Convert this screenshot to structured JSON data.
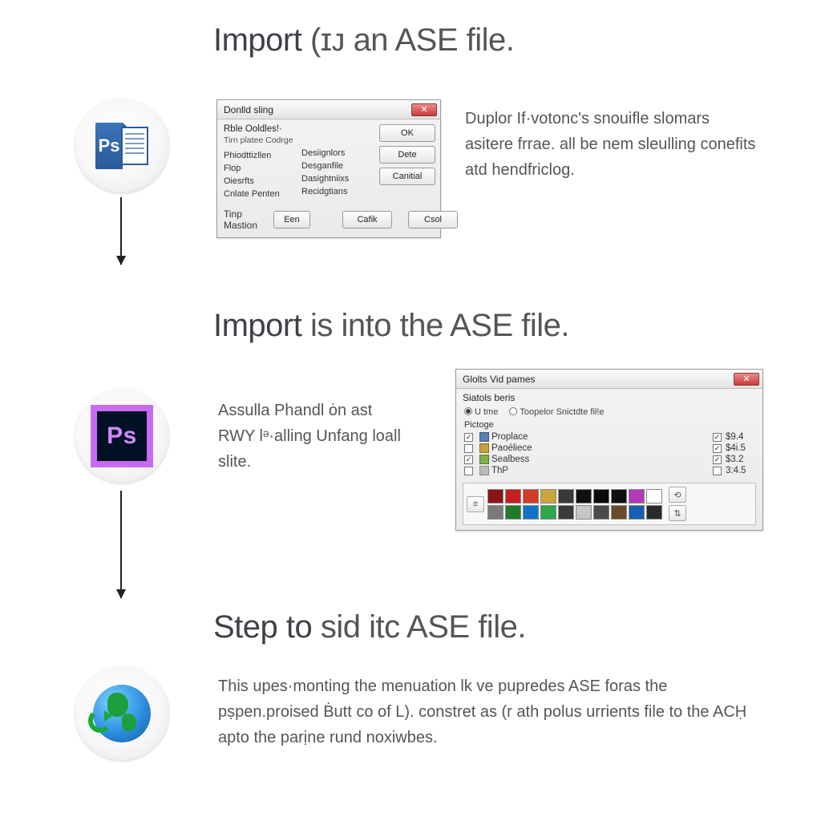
{
  "headings": {
    "h1_a": "Import",
    "h1_b": "(ɪᴊ",
    "h1_c": "an ASE file.",
    "h2_a": "Import",
    "h2_b": "is into the ASE file.",
    "h3_a": "Step to",
    "h3_b": "sid itc ASE file."
  },
  "step1": {
    "icon_letters": "Ps",
    "paragraph": "Duplor If·votonc's snouifle slomars asitere frrae. all be nem sleulling conefits atd hendfriclog.",
    "dialog": {
      "title": "Donlld sling",
      "group_title": "Rble Ooldles!·",
      "group_sub": "Tirn platee Codrge",
      "left_items": [
        "Phiodttizllen",
        "Flop",
        "Oiesrfts",
        "Cnlate Penten"
      ],
      "right_items": [
        "Desiignlors",
        "Desganfile",
        "Dasightniixs",
        "Recidgtians"
      ],
      "buttons": {
        "ok": "OK",
        "dete": "Dete",
        "canitial": "Canitial"
      },
      "footer_left": "Tinp Mastion",
      "footer_btn1": "Een",
      "footer_btn2": "Cafik",
      "footer_btn3": "Csol"
    }
  },
  "step2": {
    "icon_letters": "Ps",
    "paragraph": "Assulla Phandl ȯn ast RWY lᵊ·alling Unfang loall slite.",
    "dialog": {
      "title": "Glolts Vid pames",
      "section_label": "Siatols beris",
      "radio1": "U tme",
      "radio2": "Toopelor Snictdte fil!e",
      "subhead": "Pictoge",
      "rows": [
        {
          "name": "Proplace",
          "val": "$9.4",
          "chk": true
        },
        {
          "name": "Paoéliece",
          "val": "$4i.5",
          "chk": true
        },
        {
          "name": "Sealbess",
          "val": "$3.2",
          "chk": true
        },
        {
          "name": "ThP",
          "val": "3:4.5",
          "chk": false
        }
      ],
      "swatches_row1": [
        "#8a1416",
        "#c81e1e",
        "#d23a2a",
        "#caa63a",
        "#3a3a3a",
        "#101010",
        "#0a0a0a",
        "#101010",
        "#b23ab8",
        "#ffffff"
      ],
      "swatches_row2": [
        "#7a7a7a",
        "#1f7a2a",
        "#1173c7",
        "#2aa84a",
        "#3a3a3a",
        "#c6c6c6",
        "#4a4a4a",
        "#6a4a2a",
        "#1460b0",
        "#2a2a2a"
      ]
    }
  },
  "step3": {
    "paragraph": "This upes·monting the menuation lk ve pupredes ASE foras the pṣpen.proised Ḃutt co of L). constret as (r ath polus urrients file to the ACḤ apto the parịne rund noxiwbes."
  }
}
